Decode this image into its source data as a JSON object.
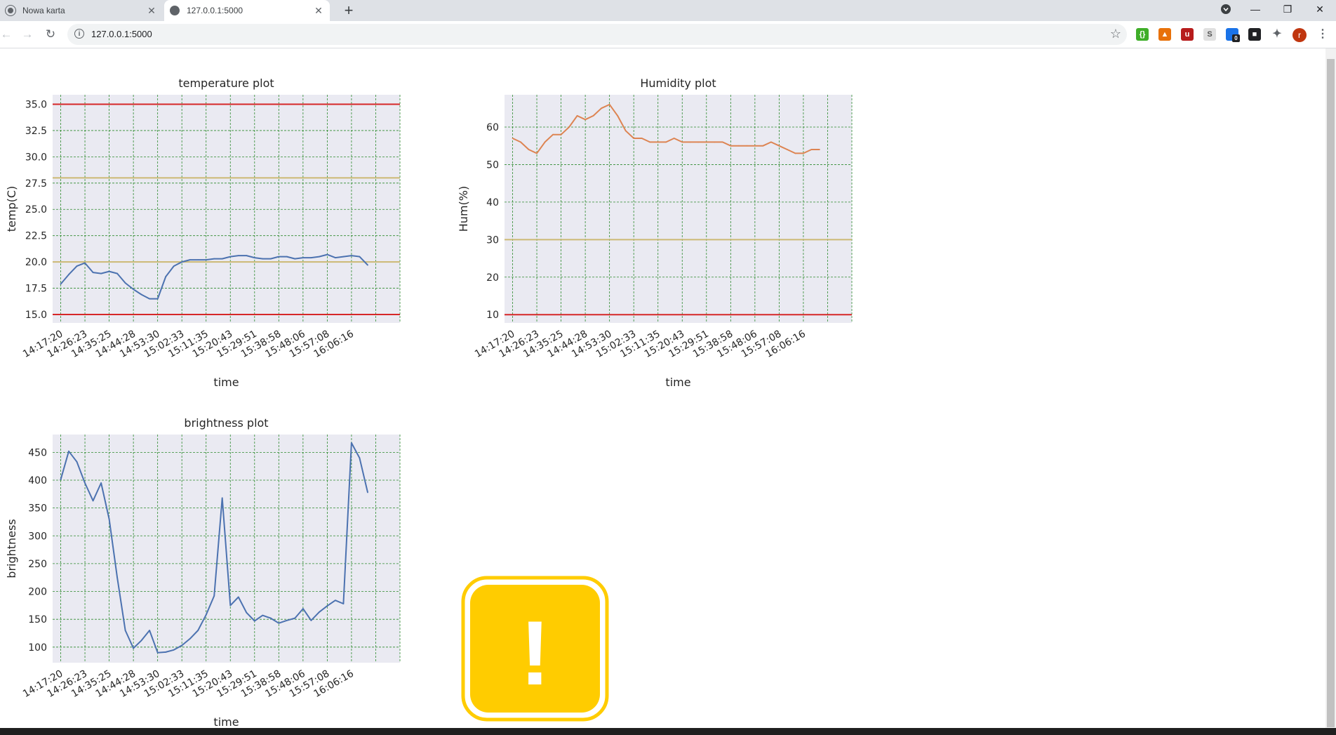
{
  "browser": {
    "tabs": [
      {
        "title": "Nowa karta",
        "active": false,
        "icon": "chrome-icon"
      },
      {
        "title": "127.0.0.1:5000",
        "active": true,
        "icon": "globe-icon"
      }
    ],
    "new_tab_label": "+",
    "close_label": "✕",
    "url": "127.0.0.1:5000",
    "extensions": [
      "green-extension-icon",
      "orange-extension-icon",
      "ublock-icon",
      "s-extension-icon",
      "blue-extension-icon",
      "dark-extension-icon",
      "puzzle-icon"
    ],
    "extension_badge": "0",
    "profile_initial": "r"
  },
  "colors": {
    "plot_bg": "#eaeaf2",
    "grid": "#2e8b2e",
    "series_blue": "#4c72b0",
    "series_orange": "#dd8452",
    "limit_red": "#d62728",
    "limit_gold": "#ccb974",
    "warning_yellow": "#ffcc00"
  },
  "chart_data": [
    {
      "type": "line",
      "title": "temperature plot",
      "xlabel": "time",
      "ylabel": "temp(C)",
      "x_ticks": [
        "14:17:20",
        "14:26:23",
        "14:35:25",
        "14:44:28",
        "14:53:30",
        "15:02:33",
        "15:11:35",
        "15:20:43",
        "15:29:51",
        "15:38:58",
        "15:48:06",
        "15:57:08",
        "16:06:16"
      ],
      "x_count": 42,
      "ylim": [
        14.2,
        35.9
      ],
      "y_ticks": [
        15.0,
        17.5,
        20.0,
        22.5,
        25.0,
        27.5,
        30.0,
        32.5,
        35.0
      ],
      "y_tick_labels": [
        "15.0",
        "17.5",
        "20.0",
        "22.5",
        "25.0",
        "27.5",
        "30.0",
        "32.5",
        "35.0"
      ],
      "grid": true,
      "series": [
        {
          "color": "#4c72b0",
          "values": [
            17.9,
            18.8,
            19.6,
            19.9,
            19.0,
            18.9,
            19.1,
            18.9,
            18.0,
            17.4,
            16.9,
            16.5,
            16.5,
            18.6,
            19.6,
            20.0,
            20.2,
            20.2,
            20.2,
            20.3,
            20.3,
            20.5,
            20.6,
            20.6,
            20.4,
            20.3,
            20.3,
            20.5,
            20.5,
            20.3,
            20.4,
            20.4,
            20.5,
            20.7,
            20.4,
            20.5,
            20.6,
            20.5,
            19.7
          ]
        }
      ],
      "hlines": [
        {
          "y": 35.0,
          "color": "#d62728"
        },
        {
          "y": 28.0,
          "color": "#ccb974"
        },
        {
          "y": 20.0,
          "color": "#ccb974"
        },
        {
          "y": 15.0,
          "color": "#d62728"
        }
      ]
    },
    {
      "type": "line",
      "title": "Humidity plot",
      "xlabel": "time",
      "ylabel": "Hum(%)",
      "x_ticks": [
        "14:17:20",
        "14:26:23",
        "14:35:25",
        "14:44:28",
        "14:53:30",
        "15:02:33",
        "15:11:35",
        "15:20:43",
        "15:29:51",
        "15:38:58",
        "15:48:06",
        "15:57:08",
        "16:06:16"
      ],
      "x_count": 42,
      "ylim": [
        7.8,
        68.6
      ],
      "y_ticks": [
        10,
        20,
        30,
        40,
        50,
        60
      ],
      "y_tick_labels": [
        "10",
        "20",
        "30",
        "40",
        "50",
        "60"
      ],
      "grid": true,
      "series": [
        {
          "color": "#dd8452",
          "values": [
            57,
            56,
            54,
            53,
            56,
            58,
            58,
            60,
            63,
            62,
            63,
            65,
            66,
            63,
            59,
            57,
            57,
            56,
            56,
            56,
            57,
            56,
            56,
            56,
            56,
            56,
            56,
            55,
            55,
            55,
            55,
            55,
            56,
            55,
            54,
            53,
            53,
            54,
            54
          ]
        }
      ],
      "hlines": [
        {
          "y": 30,
          "color": "#ccb974"
        },
        {
          "y": 10,
          "color": "#d62728"
        }
      ]
    },
    {
      "type": "line",
      "title": "brightness plot",
      "xlabel": "time",
      "ylabel": "brightness",
      "x_ticks": [
        "14:17:20",
        "14:26:23",
        "14:35:25",
        "14:44:28",
        "14:53:30",
        "15:02:33",
        "15:11:35",
        "15:20:43",
        "15:29:51",
        "15:38:58",
        "15:48:06",
        "15:57:08",
        "16:06:16"
      ],
      "x_count": 42,
      "ylim": [
        72,
        482
      ],
      "y_ticks": [
        100,
        150,
        200,
        250,
        300,
        350,
        400,
        450
      ],
      "y_tick_labels": [
        "100",
        "150",
        "200",
        "250",
        "300",
        "350",
        "400",
        "450"
      ],
      "grid": true,
      "series": [
        {
          "color": "#4c72b0",
          "values": [
            401,
            452,
            433,
            395,
            363,
            395,
            330,
            225,
            130,
            98,
            112,
            130,
            90,
            91,
            95,
            103,
            115,
            130,
            158,
            192,
            368,
            175,
            190,
            162,
            147,
            157,
            152,
            143,
            148,
            152,
            169,
            148,
            163,
            174,
            184,
            178,
            467,
            440,
            378
          ]
        }
      ],
      "hlines": []
    }
  ],
  "warning": {
    "glyph": "!",
    "icon": "warning-icon"
  }
}
